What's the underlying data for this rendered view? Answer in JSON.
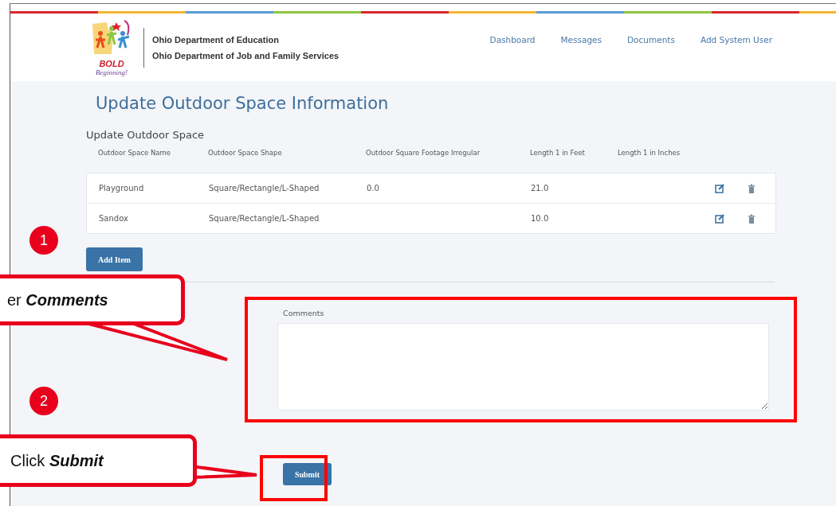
{
  "header": {
    "logo": {
      "word": "BOLD",
      "tagline": "Beginning!"
    },
    "agencies": [
      "Ohio Department of Education",
      "Ohio Department of Job and Family Services"
    ],
    "nav": [
      {
        "label": "Dashboard"
      },
      {
        "label": "Messages"
      },
      {
        "label": "Documents"
      },
      {
        "label": "Add System User"
      }
    ]
  },
  "page_title": "Update Outdoor Space Information",
  "section_title": "Update Outdoor Space",
  "table": {
    "columns": [
      "Outdoor Space Name",
      "Outdoor Space Shape",
      "Outdoor Square Footage Irregular",
      "Length 1 in Feet",
      "Length 1 in Inches"
    ],
    "rows": [
      {
        "cells": [
          "Playground",
          "Square/Rectangle/L-Shaped",
          "0.0",
          "21.0",
          ""
        ]
      },
      {
        "cells": [
          "Sandox",
          "Square/Rectangle/L-Shaped",
          "",
          "10.0",
          ""
        ]
      }
    ]
  },
  "add_button": "Add Item",
  "comments": {
    "label": "Comments"
  },
  "submit_button": "Submit",
  "annotations": {
    "steps": [
      {
        "number": "1",
        "text": "er **Comments**"
      },
      {
        "number": "2",
        "text": "Click **Submit**"
      }
    ]
  }
}
